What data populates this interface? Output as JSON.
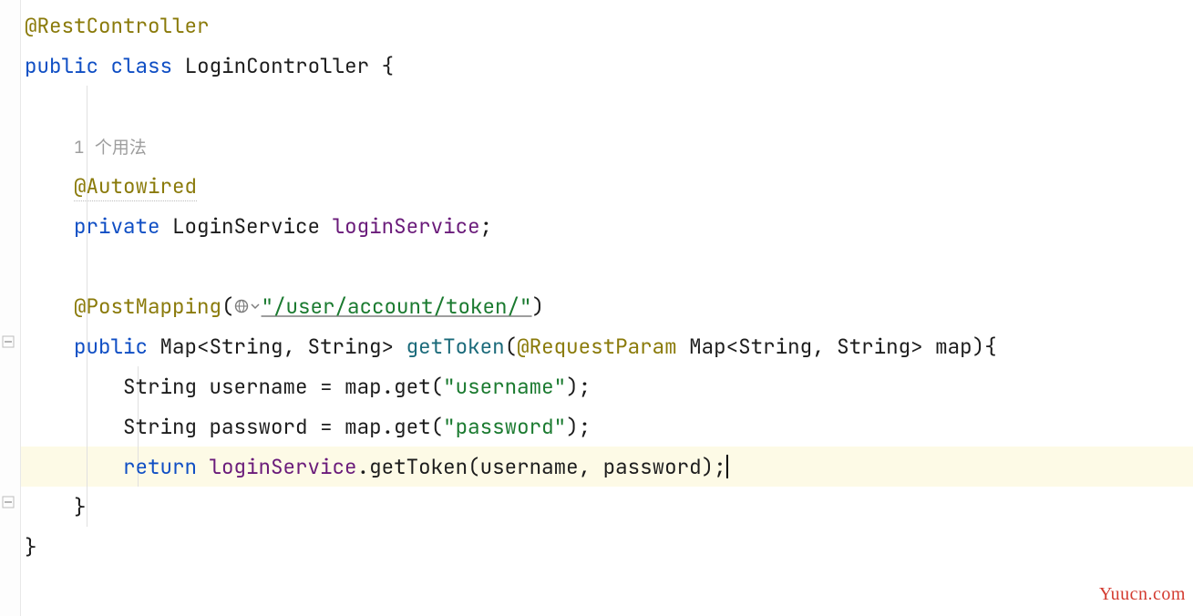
{
  "code": {
    "annotation_rest": "@RestController",
    "kw_public": "public",
    "kw_class": "class",
    "class_name": "LoginController",
    "inlay_usages": "1 个用法",
    "annotation_autowired": "@Autowired",
    "kw_private": "private",
    "type_service": "LoginService",
    "field_service": "loginService",
    "annotation_postmapping": "@PostMapping",
    "mapping_path": "\"/user/account/token/\"",
    "ret_type": "Map<String, String>",
    "method_name": "getToken",
    "annotation_requestparam": "@RequestParam",
    "param_type": "Map<String, String>",
    "param_name": "map",
    "type_string": "String",
    "var_username": "username",
    "var_password": "password",
    "map_var": "map",
    "get_call": "get",
    "key_username": "\"username\"",
    "key_password": "\"password\"",
    "kw_return": "return",
    "call_getToken": "getToken",
    "open_brace": "{",
    "close_brace": "}",
    "open_paren": "(",
    "close_paren": ")",
    "semicolon": ";",
    "dot": ".",
    "comma": ",",
    "equals": "="
  },
  "gutter": {
    "bulb": "lightbulb-icon",
    "fold_open": "fold-open-icon",
    "fold_close": "fold-close-icon"
  },
  "inline_icons": {
    "web": "web-request-icon",
    "dropdown": "chevron-down-icon"
  },
  "watermark": "Yuucn.com"
}
